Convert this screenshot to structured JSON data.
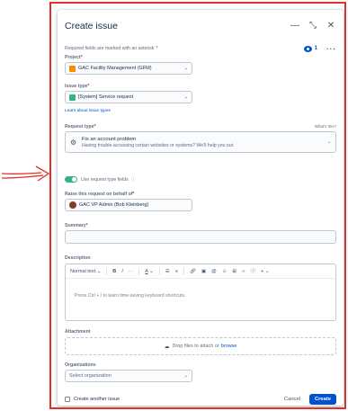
{
  "modal": {
    "title": "Create issue",
    "required_note": "Required fields are marked with an asterisk",
    "required_star": "*",
    "watchers_count": "1"
  },
  "project": {
    "label": "Project",
    "value": "GAC Facility Management (GFM)"
  },
  "issue_type": {
    "label": "Issue type",
    "value": "[System] Service request",
    "learn_link": "Learn about issue types"
  },
  "request_type": {
    "label": "Request type",
    "whats_this": "What's this?",
    "title": "Fix an account problem",
    "description": "Having trouble accessing certain websites or systems? We'll help you out."
  },
  "toggle": {
    "label": "Use request type fields"
  },
  "raise_on_behalf": {
    "label": "Raise this request on behalf of",
    "value": "GAC VP Admin (Bob Kleinberg)"
  },
  "summary": {
    "label": "Summary"
  },
  "description": {
    "label": "Description",
    "toolbar": {
      "text_style": "Normal text",
      "bold": "B",
      "italic": "I",
      "more": "···",
      "text_color": "A",
      "insert": "+"
    },
    "placeholder": "Press Ctrl + / to learn time-saving keyboard shortcuts."
  },
  "attachment": {
    "label": "Attachment",
    "drop_text": "Drop files to attach or",
    "browse": "browse"
  },
  "organizations": {
    "label": "Organizations",
    "placeholder": "Select organization"
  },
  "footer": {
    "create_another": "Create another issue",
    "cancel": "Cancel",
    "create": "Create"
  },
  "colors": {
    "arrow": "#e0302a",
    "primary": "#0052cc",
    "toggle_on": "#36b37e"
  }
}
